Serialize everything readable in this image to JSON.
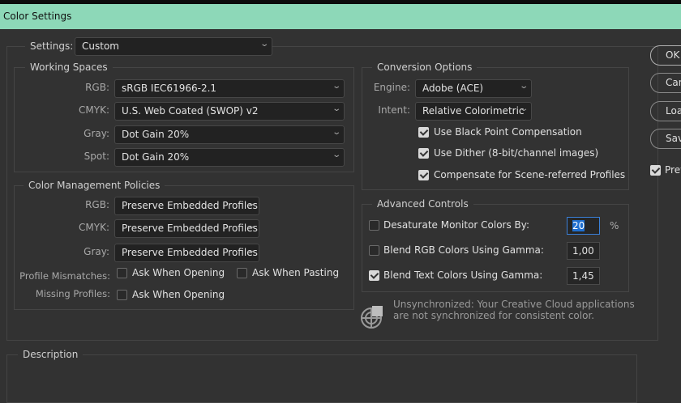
{
  "window": {
    "title": "Color Settings"
  },
  "settings": {
    "label": "Settings:",
    "value": "Custom"
  },
  "working_spaces": {
    "title": "Working Spaces",
    "rows": [
      {
        "label": "RGB:",
        "value": "sRGB IEC61966-2.1"
      },
      {
        "label": "CMYK:",
        "value": "U.S. Web Coated (SWOP) v2"
      },
      {
        "label": "Gray:",
        "value": "Dot Gain 20%"
      },
      {
        "label": "Spot:",
        "value": "Dot Gain 20%"
      }
    ]
  },
  "policies": {
    "title": "Color Management Policies",
    "rows": [
      {
        "label": "RGB:",
        "value": "Preserve Embedded Profiles"
      },
      {
        "label": "CMYK:",
        "value": "Preserve Embedded Profiles"
      },
      {
        "label": "Gray:",
        "value": "Preserve Embedded Profiles"
      }
    ],
    "mismatch_label": "Profile Mismatches:",
    "ask_opening": "Ask When Opening",
    "ask_pasting": "Ask When Pasting",
    "missing_label": "Missing Profiles:",
    "missing_ask_opening": "Ask When Opening"
  },
  "conversion": {
    "title": "Conversion Options",
    "engine_label": "Engine:",
    "engine": "Adobe (ACE)",
    "intent_label": "Intent:",
    "intent": "Relative Colorimetric",
    "checks": [
      {
        "label": "Use Black Point Compensation",
        "checked": true
      },
      {
        "label": "Use Dither (8-bit/channel images)",
        "checked": true
      },
      {
        "label": "Compensate for Scene-referred Profiles",
        "checked": true
      }
    ]
  },
  "advanced": {
    "title": "Advanced Controls",
    "rows": [
      {
        "label": "Desaturate Monitor Colors By:",
        "value": "20",
        "unit": "%",
        "checked": false
      },
      {
        "label": "Blend RGB Colors Using Gamma:",
        "value": "1,00",
        "checked": false
      },
      {
        "label": "Blend Text Colors Using Gamma:",
        "value": "1,45",
        "checked": true
      }
    ]
  },
  "sync": {
    "line1": "Unsynchronized: Your Creative Cloud applications",
    "line2": "are not synchronized for consistent color."
  },
  "buttons": {
    "ok": "OK",
    "cancel": "Cancel",
    "load": "Load...",
    "save": "Save...",
    "preview": "Preview"
  },
  "description": {
    "title": "Description"
  }
}
